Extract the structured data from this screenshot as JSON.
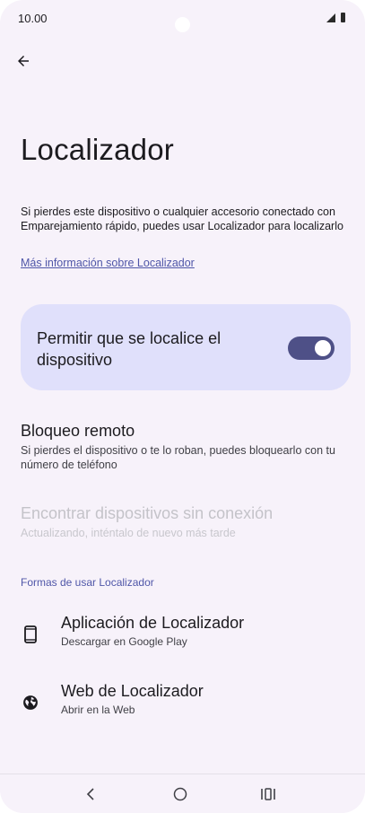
{
  "status_bar": {
    "time": "10.00"
  },
  "icons": {
    "back": "arrow-left-icon",
    "signal": "signal-icon",
    "battery": "battery-icon",
    "phone": "smartphone-icon",
    "web": "globe-icon",
    "nav_back": "nav-back-icon",
    "nav_home": "nav-home-icon",
    "nav_recents": "nav-recents-icon"
  },
  "page": {
    "title": "Localizador",
    "description": "Si pierdes este dispositivo o cualquier accesorio conectado con Emparejamiento rápido, puedes usar Localizador para localizarlo",
    "learn_more": "Más información sobre Localizador"
  },
  "toggle": {
    "label": "Permitir que se localice el dispositivo",
    "enabled": true
  },
  "remote_lock": {
    "title": "Bloqueo remoto",
    "subtitle": "Si pierdes el dispositivo o te lo roban, puedes bloquearlo con tu número de teléfono"
  },
  "offline_devices": {
    "title": "Encontrar dispositivos sin conexión",
    "subtitle": "Actualizando, inténtalo de nuevo más tarde"
  },
  "ways_section": {
    "header": "Formas de usar Localizador",
    "items": [
      {
        "title": "Aplicación de Localizador",
        "subtitle": "Descargar en Google Play"
      },
      {
        "title": "Web de Localizador",
        "subtitle": "Abrir en la Web"
      }
    ]
  },
  "colors": {
    "background": "#f7f2fa",
    "card": "#e0e0fb",
    "accent": "#4e5087",
    "link": "#4f56a8",
    "disabled_text": "#c4c3c9"
  }
}
